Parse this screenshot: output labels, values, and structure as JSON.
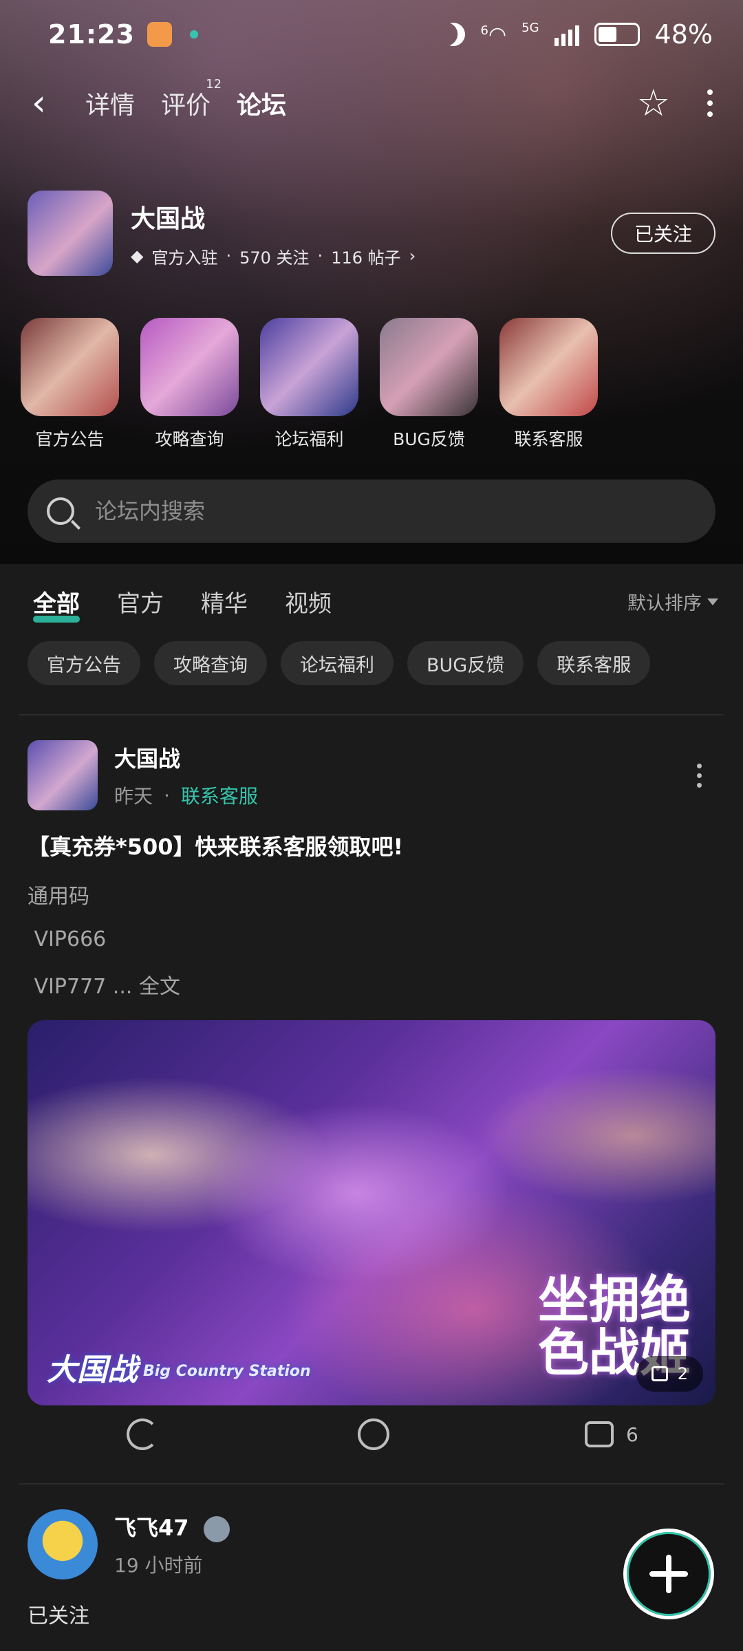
{
  "status": {
    "time": "21:23",
    "network_small": "6",
    "network_type": "5G",
    "battery": "48%"
  },
  "nav": {
    "back_icon": "‹",
    "tabs": [
      {
        "label": "详情"
      },
      {
        "label": "评价",
        "badge": "12"
      },
      {
        "label": "论坛"
      }
    ],
    "star_icon": "☆"
  },
  "game": {
    "name": "大国战",
    "official": "官方入驻",
    "follows": "570 关注",
    "posts": "116 帖子",
    "follow_button": "已关注"
  },
  "shortcuts": [
    {
      "label": "官方公告"
    },
    {
      "label": "攻略查询"
    },
    {
      "label": "论坛福利"
    },
    {
      "label": "BUG反馈"
    },
    {
      "label": "联系客服"
    }
  ],
  "search": {
    "placeholder": "论坛内搜索"
  },
  "filter_tabs": [
    {
      "label": "全部"
    },
    {
      "label": "官方"
    },
    {
      "label": "精华"
    },
    {
      "label": "视频"
    }
  ],
  "sort_label": "默认排序",
  "chips": [
    {
      "label": "官方公告"
    },
    {
      "label": "攻略查询"
    },
    {
      "label": "论坛福利"
    },
    {
      "label": "BUG反馈"
    },
    {
      "label": "联系客服"
    }
  ],
  "post1": {
    "author": "大国战",
    "time": "昨天",
    "category": "联系客服",
    "title": "【真充券*500】快来联系客服领取吧!",
    "lines": [
      "通用码",
      " VIP666",
      " VIP777 ... 全文"
    ],
    "image_logo": "大国战",
    "image_logo_en": "Big Country Station",
    "image_slogan": "坐拥绝色战姬",
    "image_count": "2",
    "like_count": "6"
  },
  "post2": {
    "author": "飞飞47",
    "time": "19 小时前",
    "text": "已关注"
  },
  "colors": {
    "accent": "#2ec2a8",
    "background": "#1b1b1b"
  }
}
